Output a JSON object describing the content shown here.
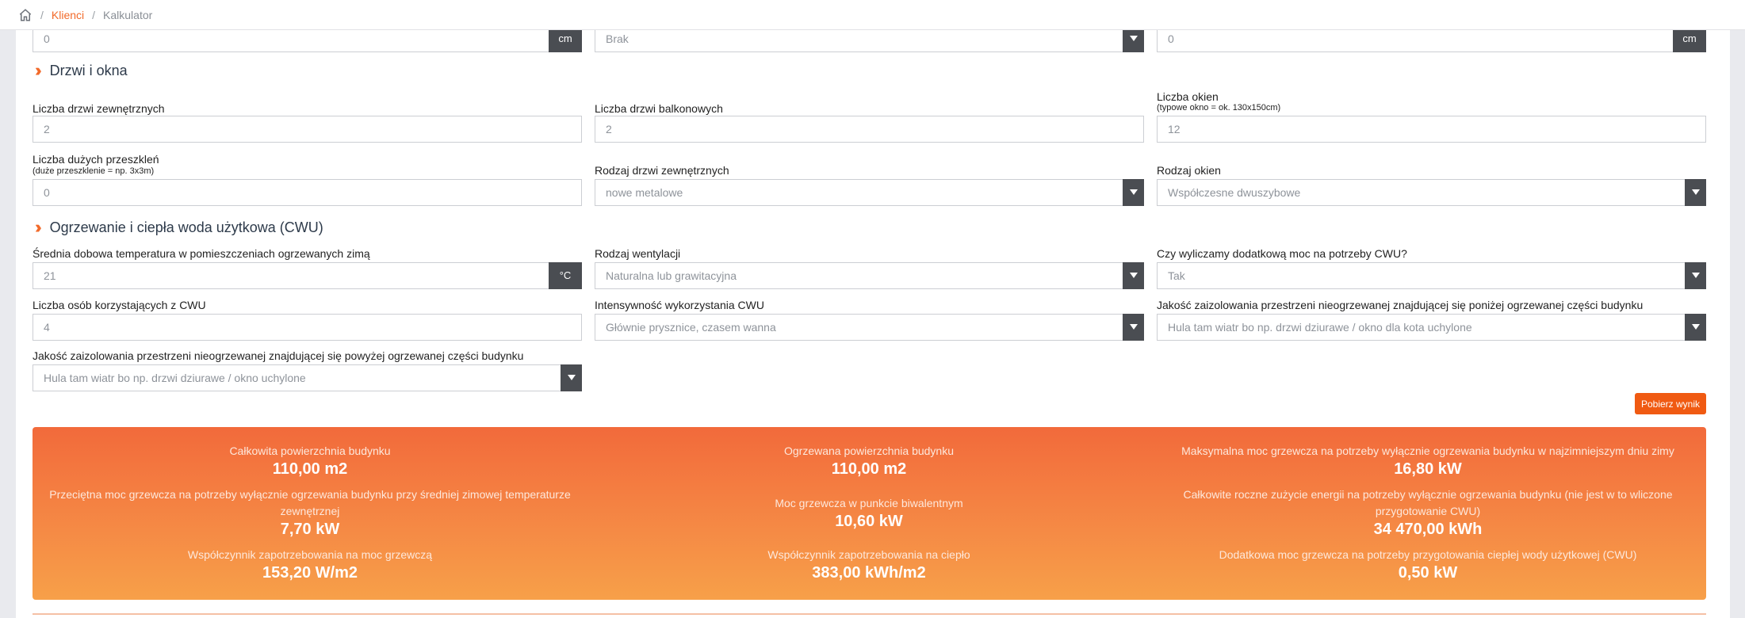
{
  "breadcrumb": {
    "link": "Klienci",
    "current": "Kalkulator",
    "sep": "/"
  },
  "top_row": [
    {
      "value": "0",
      "addon": "cm"
    },
    {
      "value": "Brak"
    },
    {
      "value": "0",
      "addon": "cm"
    }
  ],
  "sections": {
    "doors": "Drzwi i okna",
    "heating": "Ogrzewanie i ciepła woda użytkowa (CWU)"
  },
  "fields": {
    "ext_doors": {
      "label": "Liczba drzwi zewnętrznych",
      "value": "2"
    },
    "balcony_doors": {
      "label": "Liczba drzwi balkonowych",
      "value": "2"
    },
    "windows": {
      "label": "Liczba okien",
      "sub": "(typowe okno = ok. 130x150cm)",
      "value": "12"
    },
    "large_glazing": {
      "label": "Liczba dużych przeszkleń",
      "sub": "(duże przeszklenie = np. 3x3m)",
      "value": "0"
    },
    "ext_door_type": {
      "label": "Rodzaj drzwi zewnętrznych",
      "value": "nowe metalowe"
    },
    "window_type": {
      "label": "Rodzaj okien",
      "value": "Współczesne dwuszybowe"
    },
    "avg_temp": {
      "label": "Średnia dobowa temperatura w pomieszczeniach ogrzewanych zimą",
      "value": "21",
      "addon": "°C"
    },
    "ventilation": {
      "label": "Rodzaj wentylacji",
      "value": "Naturalna lub grawitacyjna"
    },
    "cwu_power": {
      "label": "Czy wyliczamy dodatkową moc na potrzeby CWU?",
      "value": "Tak"
    },
    "cwu_people": {
      "label": "Liczba osób korzystających z CWU",
      "value": "4"
    },
    "cwu_intensity": {
      "label": "Intensywność wykorzystania CWU",
      "value": "Głównie prysznice, czasem wanna"
    },
    "insulation_below": {
      "label": "Jakość zaizolowania przestrzeni nieogrzewanej znajdującej się poniżej ogrzewanej części budynku",
      "value": "Hula tam wiatr bo np. drzwi dziurawe / okno dla kota uchylone"
    },
    "insulation_above": {
      "label": "Jakość zaizolowania przestrzeni nieogrzewanej znajdującej się powyżej ogrzewanej części budynku",
      "value": "Hula tam wiatr bo np. drzwi dziurawe / okno uchylone"
    }
  },
  "button": {
    "result": "Pobierz wynik"
  },
  "results": {
    "total_area": {
      "label": "Całkowita powierzchnia budynku",
      "value": "110,00 m2"
    },
    "heated_area": {
      "label": "Ogrzewana powierzchnia budynku",
      "value": "110,00 m2"
    },
    "max_power": {
      "label": "Maksymalna moc grzewcza na potrzeby wyłącznie ogrzewania budynku w najzimniejszym dniu zimy",
      "value": "16,80 kW"
    },
    "avg_power": {
      "label": "Przeciętna moc grzewcza na potrzeby wyłącznie ogrzewania budynku przy średniej zimowej temperaturze zewnętrznej",
      "value": "7,70 kW"
    },
    "bivalent_power": {
      "label": "Moc grzewcza w punkcie biwalentnym",
      "value": "10,60 kW"
    },
    "annual_energy": {
      "label": "Całkowite roczne zużycie energii na potrzeby wyłącznie ogrzewania budynku (nie jest w to wliczone przygotowanie CWU)",
      "value": "34 470,00 kWh"
    },
    "power_factor": {
      "label": "Współczynnik zapotrzebowania na moc grzewczą",
      "value": "153,20 W/m2"
    },
    "heat_factor": {
      "label": "Współczynnik zapotrzebowania na ciepło",
      "value": "383,00 kWh/m2"
    },
    "cwu_extra": {
      "label": "Dodatkowa moc grzewcza na potrzeby przygotowania ciepłej wody użytkowej (CWU)",
      "value": "0,50 kW"
    }
  }
}
